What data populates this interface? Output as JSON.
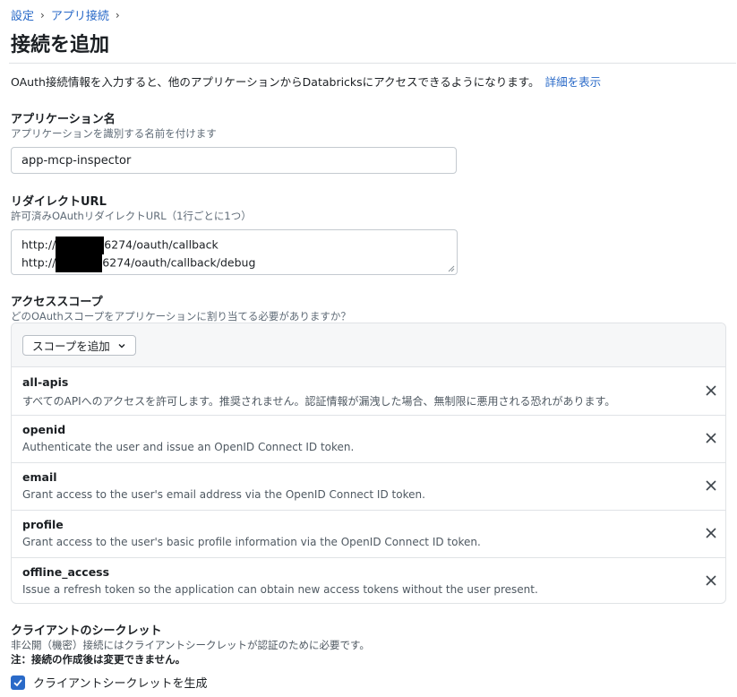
{
  "breadcrumb": {
    "items": [
      "設定",
      "アプリ接続"
    ]
  },
  "page": {
    "title": "接続を追加",
    "intro": "OAuth接続情報を入力すると、他のアプリケーションからDatabricksにアクセスできるようになります。",
    "details_link": "詳細を表示"
  },
  "app_name": {
    "label": "アプリケーション名",
    "hint": "アプリケーションを識別する名前を付けます",
    "value": "app-mcp-inspector"
  },
  "redirect": {
    "label": "リダイレクトURL",
    "hint": "許可済みOAuthリダイレクトURL（1行ごとに1つ）",
    "lines": [
      {
        "prefix": "http://",
        "suffix": "6274/oauth/callback"
      },
      {
        "prefix": "http://",
        "suffix": "6274/oauth/callback/debug"
      }
    ]
  },
  "scopes": {
    "label": "アクセススコープ",
    "hint": "どのOAuthスコープをアプリケーションに割り当てる必要がありますか？",
    "add_button": "スコープを追加",
    "items": [
      {
        "name": "all-apis",
        "desc": "すべてのAPIへのアクセスを許可します。推奨されません。認証情報が漏洩した場合、無制限に悪用される恐れがあります。"
      },
      {
        "name": "openid",
        "desc": "Authenticate the user and issue an OpenID Connect ID token."
      },
      {
        "name": "email",
        "desc": "Grant access to the user's email address via the OpenID Connect ID token."
      },
      {
        "name": "profile",
        "desc": "Grant access to the user's basic profile information via the OpenID Connect ID token."
      },
      {
        "name": "offline_access",
        "desc": "Issue a refresh token so the application can obtain new access tokens without the user present."
      }
    ]
  },
  "secret": {
    "label": "クライアントのシークレット",
    "hint": "非公開（機密）接続にはクライアントシークレットが認証のために必要です。",
    "note": "注：接続の作成後は変更できません。",
    "checkbox_label": "クライアントシークレットを生成",
    "checked": true
  },
  "colors": {
    "accent": "#2a6ac8",
    "border": "#c4cad0",
    "muted": "#5f6b77"
  }
}
